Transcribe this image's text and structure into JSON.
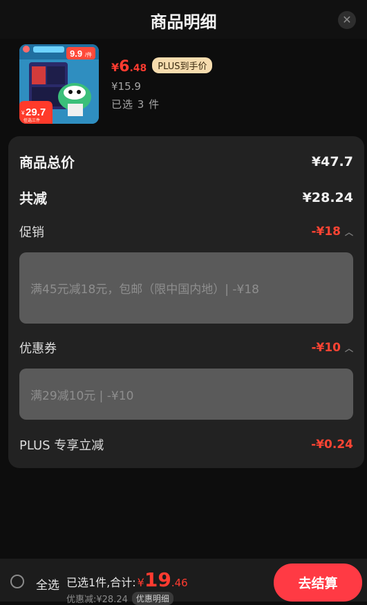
{
  "header": {
    "title": "商品明细",
    "close_icon": "close-icon"
  },
  "product": {
    "thumb_badge_price": "9.9",
    "thumb_badge_unit": "/件",
    "thumb_bottom_price": "29.7",
    "thumb_bottom_cur": "¥",
    "thumb_bottom_note": "任选三件",
    "price_currency": "¥",
    "price_int": "6",
    "price_dec": ".48",
    "plus_tag": "PLUS到手价",
    "original_price": "¥15.9",
    "selected_count": "已选 3 件"
  },
  "summary": {
    "total_label": "商品总价",
    "total_value": "¥47.7",
    "reduce_label": "共减",
    "reduce_value": "¥28.24",
    "promo_label": "促销",
    "promo_value": "-¥18",
    "promo_detail": "满45元减18元，包邮（限中国内地）| -¥18",
    "coupon_label": "优惠券",
    "coupon_value": "-¥10",
    "coupon_detail": "满29减10元 | -¥10",
    "plus_label": "PLUS 专享立减",
    "plus_value": "-¥0.24"
  },
  "bottom": {
    "select_all": "全选",
    "sum_label": "已选1件,合计:",
    "sum_currency": "¥",
    "sum_int": "19",
    "sum_dec": ".46",
    "discount_text": "优惠减:¥28.24",
    "discount_detail": "优惠明细",
    "checkout": "去结算"
  },
  "colors": {
    "accent_red": "#ff3b30",
    "checkout_bg": "#ff3a44",
    "plus_tag_bg": "#f6dcae"
  }
}
